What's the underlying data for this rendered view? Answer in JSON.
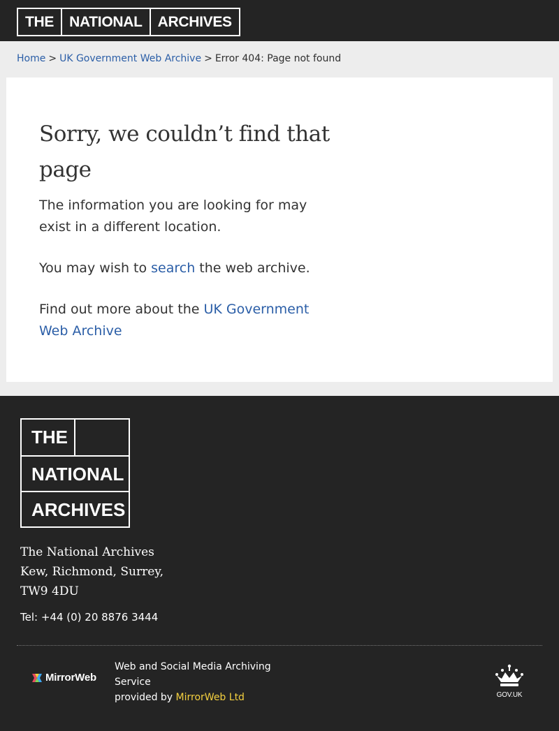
{
  "header": {
    "logo_words": [
      "THE",
      "NATIONAL",
      "ARCHIVES"
    ]
  },
  "breadcrumb": {
    "items": [
      {
        "label": "Home"
      },
      {
        "label": "UK Government Web Archive"
      },
      {
        "label": "Error 404: Page not found"
      }
    ],
    "separator": ">"
  },
  "main": {
    "title": "Sorry, we couldn’t find that page",
    "intro": "The information you are looking for may exist in a different location.",
    "search_prefix": "You may wish to ",
    "search_link": "search",
    "search_suffix": " the web archive.",
    "more_prefix": "Find out more about the ",
    "more_link": "UK Government Web Archive"
  },
  "footer": {
    "logo_words": [
      "THE",
      "NATIONAL",
      "ARCHIVES"
    ],
    "address_lines": [
      "The National Archives",
      "Kew, Richmond, Surrey,",
      "TW9 4DU"
    ],
    "tel": "Tel: +44 (0) 20 8876 3444",
    "mirrorweb_logo_text": "MirrorWeb",
    "service_line1": "Web and Social Media Archiving Service",
    "service_prefix": "provided by ",
    "service_link": "MirrorWeb Ltd",
    "govuk_label": "GOV.UK",
    "colors": {
      "link_accent": "#f4d03f"
    }
  },
  "colors": {
    "header_bg": "#242424",
    "link": "#2b5ea7",
    "page_bg": "#ededed"
  }
}
